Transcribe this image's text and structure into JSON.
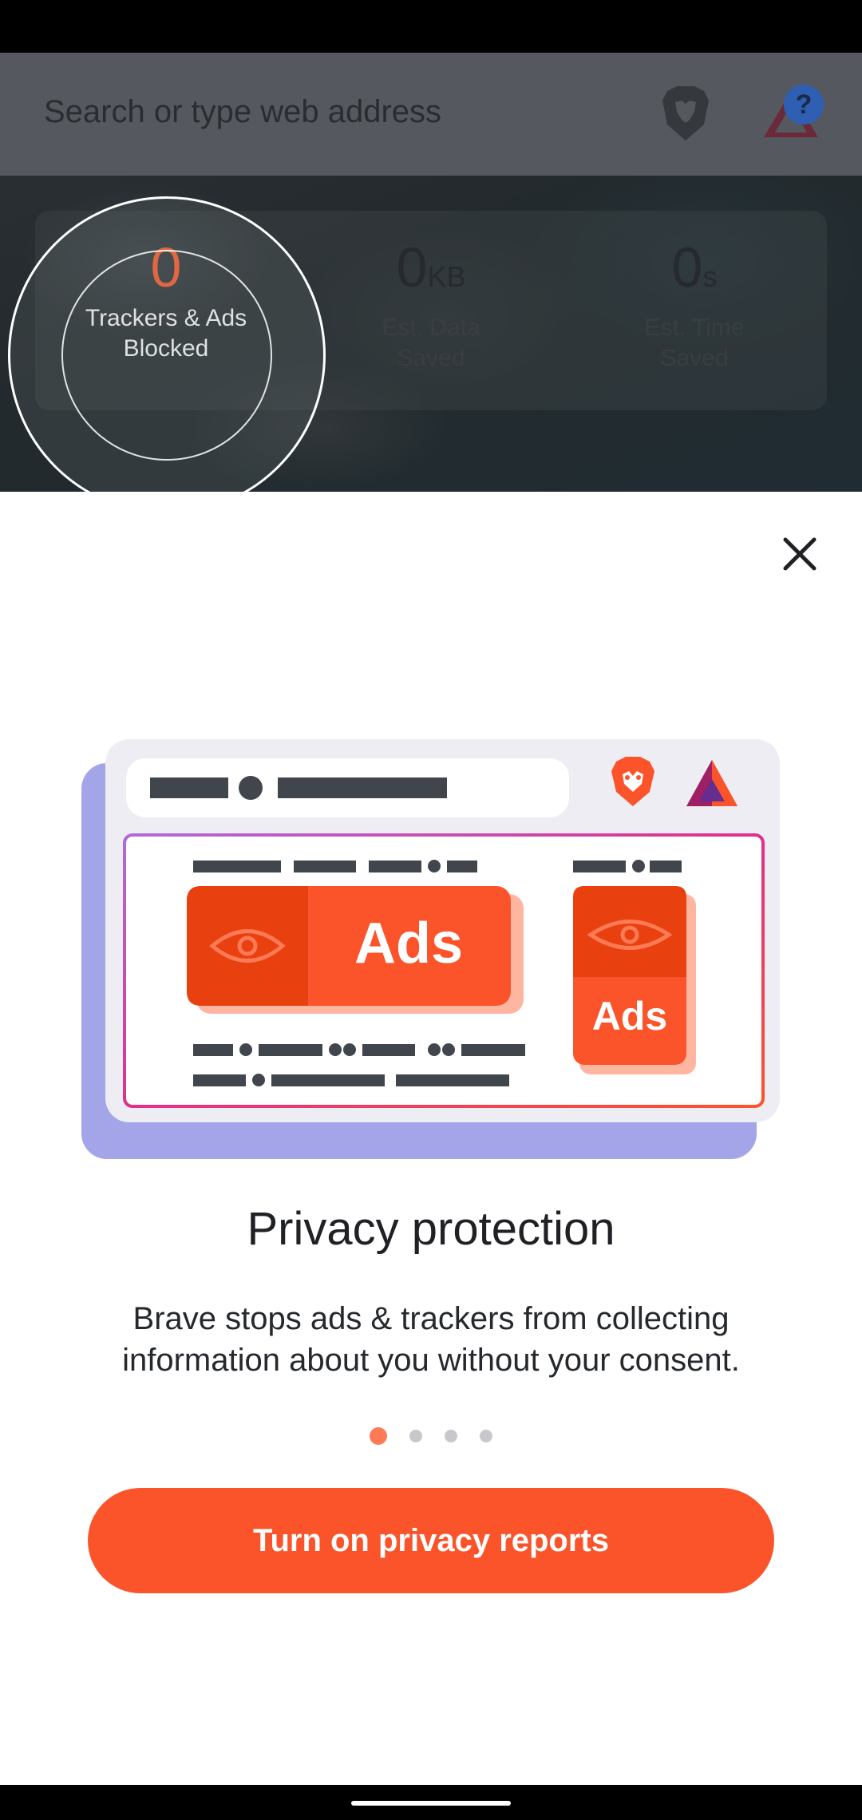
{
  "search": {
    "placeholder": "Search or type web address"
  },
  "rewards": {
    "badge": "?"
  },
  "stats": [
    {
      "value": "0",
      "unit": "",
      "label_line1": "Trackers & Ads",
      "label_line2": "Blocked"
    },
    {
      "value": "0",
      "unit": "KB",
      "label_line1": "Est. Data",
      "label_line2": "Saved"
    },
    {
      "value": "0",
      "unit": "s",
      "label_line1": "Est. Time",
      "label_line2": "Saved"
    }
  ],
  "illustration": {
    "big_ad_label": "Ads",
    "small_ad_label": "Ads"
  },
  "onboarding": {
    "title": "Privacy protection",
    "description": "Brave stops ads & trackers from collecting information about you without your consent.",
    "pages_total": 4,
    "current_page": 1,
    "cta": "Turn on privacy reports"
  },
  "colors": {
    "accent": "#fb542b",
    "stat_highlight": "#ff6332",
    "pager_active": "#ff7a55",
    "frame_purple": "#a3a5e8"
  },
  "icons": [
    "brave-lion-icon",
    "bat-triangle-icon",
    "close-icon",
    "eye-icon"
  ]
}
